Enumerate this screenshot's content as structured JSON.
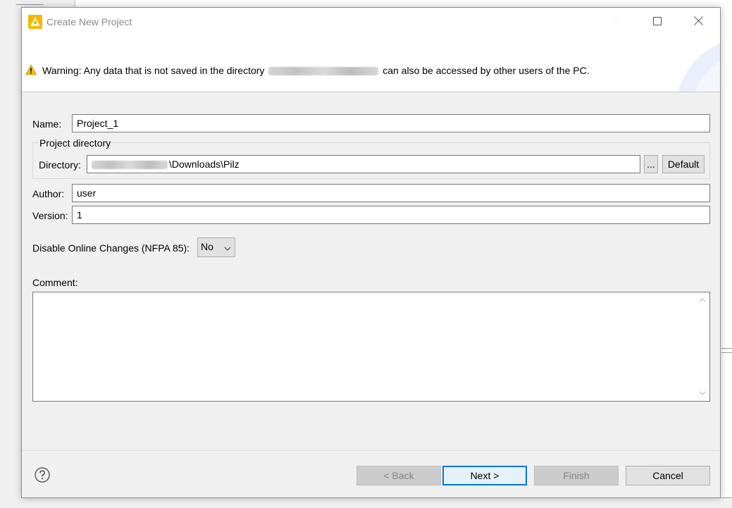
{
  "window": {
    "title": "Create New Project"
  },
  "header": {
    "warning_prefix": "Warning: Any data that is not saved in the directory",
    "warning_suffix": "can also be accessed by other users of the PC."
  },
  "form": {
    "name_label": "Name:",
    "name_value": "Project_1",
    "project_directory_title": "Project directory",
    "directory_label": "Directory:",
    "directory_value_suffix": "\\Downloads\\Pilz",
    "browse_label": "...",
    "default_label": "Default",
    "author_label": "Author:",
    "author_value": "user",
    "version_label": "Version:",
    "version_value": "1",
    "online_changes_label": "Disable Online Changes (NFPA 85):",
    "online_changes_value": "No",
    "comment_label": "Comment:",
    "comment_value": ""
  },
  "footer": {
    "back_label": "< Back",
    "next_label": "Next >",
    "finish_label": "Finish",
    "cancel_label": "Cancel"
  },
  "icons": {
    "app": "app-logo-icon",
    "warning": "warning-icon",
    "help": "help-icon",
    "minimize": "minimize-icon",
    "maximize": "maximize-icon",
    "close": "close-icon",
    "dropdown": "chevron-down-icon"
  },
  "colors": {
    "accent": "#0078d7",
    "warning": "#f2b91a",
    "dialog_bg": "#f0f0f0"
  }
}
